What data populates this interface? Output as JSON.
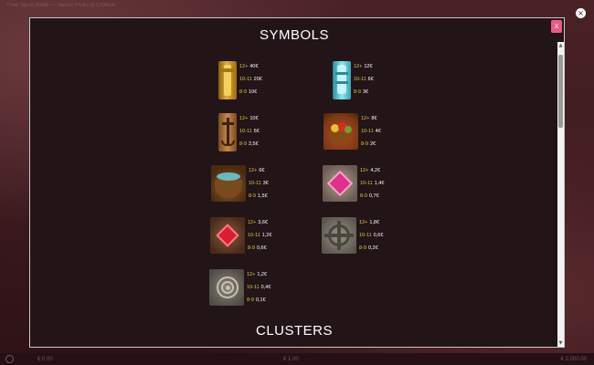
{
  "background": {
    "title": "Free Spins Mode — Nexus Fruits of Chance",
    "bottom_left": "€ 0.00",
    "bottom_mid": "€ 1.00",
    "bottom_right": "€ 2,000.00"
  },
  "colors": {
    "modal_bg": "#231418",
    "accent_pink": "#e85c86",
    "count_yellow": "#d8cf3c"
  },
  "overlay_close": "×",
  "modal": {
    "close_label": "X",
    "symbols_heading": "SYMBOLS",
    "clusters_heading": "CLUSTERS"
  },
  "symbols": [
    {
      "icon": "gold-idol-icon",
      "pays": [
        {
          "count": "12+",
          "amount": "40€"
        },
        {
          "count": "10-11",
          "amount": "20€"
        },
        {
          "count": "8-9",
          "amount": "10€"
        }
      ]
    },
    {
      "icon": "crystal-idol-icon",
      "pays": [
        {
          "count": "12+",
          "amount": "12€"
        },
        {
          "count": "10-11",
          "amount": "6€"
        },
        {
          "count": "8-9",
          "amount": "3€"
        }
      ]
    },
    {
      "icon": "anchor-icon",
      "pays": [
        {
          "count": "12+",
          "amount": "10€"
        },
        {
          "count": "10-11",
          "amount": "5€"
        },
        {
          "count": "8-9",
          "amount": "2,5€"
        }
      ]
    },
    {
      "icon": "fruit-basket-icon",
      "pays": [
        {
          "count": "12+",
          "amount": "8€"
        },
        {
          "count": "10-11",
          "amount": "4€"
        },
        {
          "count": "8-9",
          "amount": "2€"
        }
      ]
    },
    {
      "icon": "fish-basket-icon",
      "pays": [
        {
          "count": "12+",
          "amount": "6€"
        },
        {
          "count": "10-11",
          "amount": "3€"
        },
        {
          "count": "8-9",
          "amount": "1,5€"
        }
      ]
    },
    {
      "icon": "pink-gem-icon",
      "pays": [
        {
          "count": "12+",
          "amount": "4,2€"
        },
        {
          "count": "10-11",
          "amount": "1,4€"
        },
        {
          "count": "8-9",
          "amount": "0,7€"
        }
      ]
    },
    {
      "icon": "red-gem-icon",
      "pays": [
        {
          "count": "12+",
          "amount": "3,6€"
        },
        {
          "count": "10-11",
          "amount": "1,2€"
        },
        {
          "count": "8-9",
          "amount": "0,6€"
        }
      ]
    },
    {
      "icon": "stone-compass-icon",
      "pays": [
        {
          "count": "12+",
          "amount": "1,8€"
        },
        {
          "count": "10-11",
          "amount": "0,6€"
        },
        {
          "count": "8-9",
          "amount": "0,2€"
        }
      ]
    },
    {
      "icon": "shell-fossil-icon",
      "pays": [
        {
          "count": "12+",
          "amount": "1,2€"
        },
        {
          "count": "10-11",
          "amount": "0,4€"
        },
        {
          "count": "8-9",
          "amount": "0,1€"
        }
      ]
    }
  ]
}
